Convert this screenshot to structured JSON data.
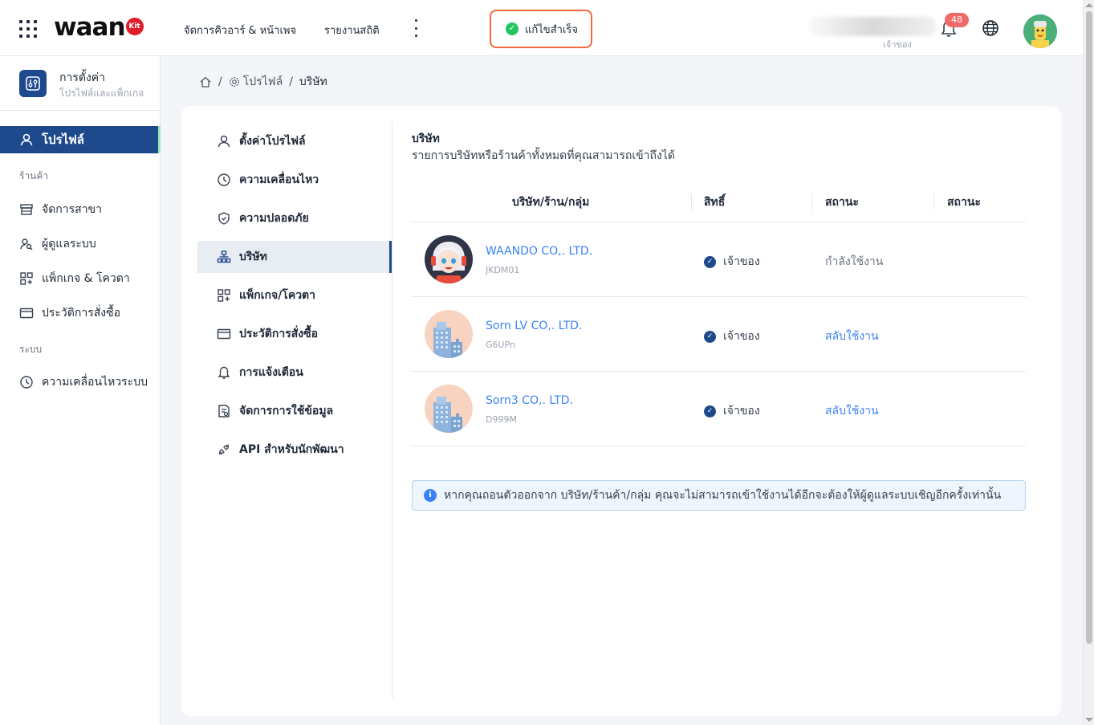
{
  "header": {
    "logo_text": "waan",
    "logo_badge": "Kit",
    "nav": [
      "จัดการคิวอาร์ & หน้าเพจ",
      "รายงานสถิติ"
    ],
    "toast": "แก้ไขสำเร็จ",
    "user_role": "เจ้าของ",
    "notification_count": "48"
  },
  "sidebar": {
    "title": "การตั้งค่า",
    "subtitle": "โปรไฟล์และแพ็กเกจ",
    "active_item": "โปรไฟล์",
    "section_store": "ร้านค้า",
    "store_items": [
      "จัดการสาขา",
      "ผู้ดูแลระบบ",
      "แพ็กเกจ & โควตา",
      "ประวัติการสั่งซื้อ"
    ],
    "section_system": "ระบบ",
    "system_items": [
      "ความเคลื่อนไหวระบบ"
    ]
  },
  "breadcrumb": {
    "profile": "โปรไฟล์",
    "current": "บริษัท"
  },
  "subnav": [
    {
      "label": "ตั้งค่าโปรไฟล์",
      "icon": "user-icon"
    },
    {
      "label": "ความเคลื่อนไหว",
      "icon": "history-icon"
    },
    {
      "label": "ความปลอดภัย",
      "icon": "shield-icon"
    },
    {
      "label": "บริษัท",
      "icon": "org-icon",
      "active": true
    },
    {
      "label": "แพ็กเกจ/โควตา",
      "icon": "package-icon"
    },
    {
      "label": "ประวัติการสั่งซื้อ",
      "icon": "card-icon"
    },
    {
      "label": "การแจ้งเตือน",
      "icon": "bell-icon"
    },
    {
      "label": "จัดการการใช้ข้อมูล",
      "icon": "data-icon"
    },
    {
      "label": "API สำหรับนักพัฒนา",
      "icon": "api-icon"
    }
  ],
  "section": {
    "title": "บริษัท",
    "subtitle": "รายการบริษัทหรือร้านค้าทั้งหมดที่คุณสามารถเข้าถึงได้"
  },
  "table": {
    "headers": [
      "บริษัท/ร้าน/กลุ่ม",
      "สิทธิ์",
      "สถานะ",
      "สถานะ"
    ],
    "rows": [
      {
        "name": "WAANDO CO,. LTD.",
        "code": "JKDM01",
        "role": "เจ้าของ",
        "status": "กำลังใช้งาน",
        "avatar": "girl-avatar"
      },
      {
        "name": "Sorn LV CO,. LTD.",
        "code": "G6UPn",
        "role": "เจ้าของ",
        "status": "สลับใช้งาน",
        "avatar": "building-avatar"
      },
      {
        "name": "Sorn3 CO,. LTD.",
        "code": "D999M",
        "role": "เจ้าของ",
        "status": "สลับใช้งาน",
        "avatar": "building-avatar"
      }
    ]
  },
  "info": "หากคุณถอนตัวออกจาก บริษัท/ร้านค้า/กลุ่ม คุณจะไม่สามารถเข้าใช้งานได้อีกจะต้องให้ผู้ดูแลระบบเชิญอีกครั้งเท่านั้น",
  "colors": {
    "primary": "#1e4a8d",
    "link": "#3b82f6",
    "toast_border": "#f26b3a",
    "success": "#22c55e"
  }
}
